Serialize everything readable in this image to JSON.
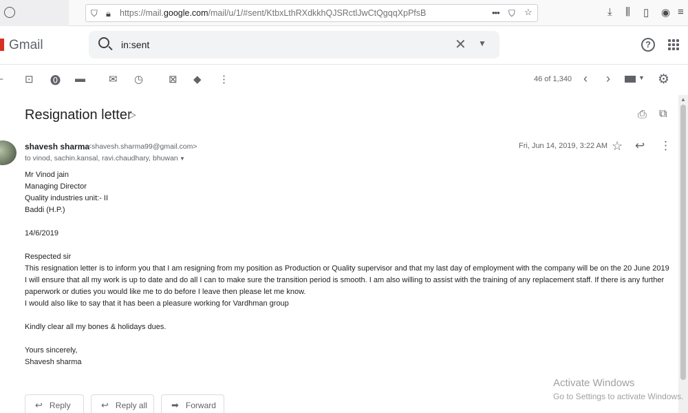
{
  "browser": {
    "url_prefix": "https://mail.",
    "url_domain": "google.com",
    "url_rest": "/mail/u/1/#sent/KtbxLthRXdkkhQJSRctlJwCtQgqqXpPfsB",
    "more": "•••"
  },
  "gmail": {
    "logo": "Gmail",
    "search_value": "in:sent"
  },
  "toolbar": {
    "count": "46 of 1,340"
  },
  "email": {
    "subject": "Resignation letter",
    "sender_name": "shavesh sharma",
    "sender_email": "<shavesh.sharma99@gmail.com>",
    "recipients": "to vinod, sachin.kansal, ravi.chaudhary, bhuwan",
    "date": "Fri, Jun 14, 2019, 3:22 AM",
    "body": {
      "l1": "Mr Vinod jain",
      "l2": "Managing Director",
      "l3": "Quality industries unit:- II",
      "l4": "Baddi (H.P.)",
      "l5": "14/6/2019",
      "l6": "Respected sir",
      "l7": "This resignation letter is to inform you that I am resigning from my position as Production or Quality  supervisor and that my last day of employment with the company will be on the 20 June 2019",
      "l8": "I will ensure that all my work is up to date and do all I can to make sure the transition period is smooth. I am also willing to assist with the training of any replacement staff. If there is any further",
      "l9": "paperwork or duties you would like me to do before I leave then please let me know.",
      "l10": "I would also like to say that it has been a pleasure working for Vardhman group",
      "l11": "Kindly clear all my bones & holidays dues.",
      "l12": "Yours sincerely,",
      "l13": "Shavesh sharma"
    }
  },
  "actions": {
    "reply": "Reply",
    "reply_all": "Reply all",
    "forward": "Forward"
  },
  "watermark": {
    "line1": "Activate Windows",
    "line2": "Go to Settings to activate Windows."
  }
}
